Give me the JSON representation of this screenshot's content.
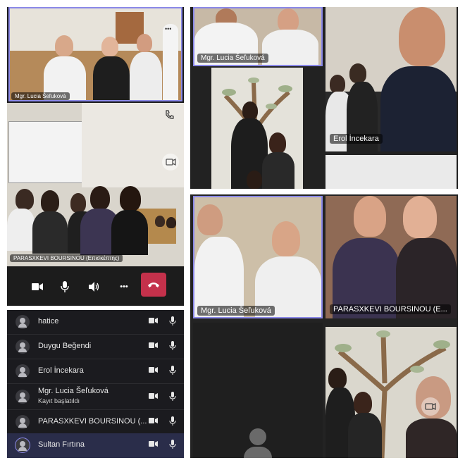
{
  "tiles": {
    "top_left_name": "Mgr. Lucia Šeľuková",
    "call_main_name": "PARASXKEVI BOURSINOU (Επισκέπτης)",
    "top_mid_name": "Mgr. Lucia Šeľuková",
    "top_right_name": "Erol İncekara",
    "mid_left_name": "Mgr. Lucia Šeľuková",
    "mid_right_name": "PARASXKEVI BOURSINOU (E..."
  },
  "call_controls": {
    "more_top": "•••",
    "more": "•••"
  },
  "participants": [
    {
      "name": "hatice",
      "status": ""
    },
    {
      "name": "Duygu Beğendi",
      "status": ""
    },
    {
      "name": "Erol İncekara",
      "status": ""
    },
    {
      "name": "Mgr. Lucia Šeľuková",
      "status": "Kayıt başlatıldı"
    },
    {
      "name": "PARASXKEVI BOURSINOU (...",
      "status": ""
    },
    {
      "name": "Sultan Fırtına",
      "status": ""
    }
  ],
  "colors": {
    "end_call": "#c4314b",
    "panel_dark": "#1f1f1f",
    "list_bg": "#1b1b1f",
    "active_border": "#8a88e8"
  },
  "icons": [
    "camera-icon",
    "microphone-icon",
    "speaker-icon",
    "more-icon",
    "end-call-icon",
    "phone-icon",
    "camera-switch-icon",
    "person-icon"
  ]
}
